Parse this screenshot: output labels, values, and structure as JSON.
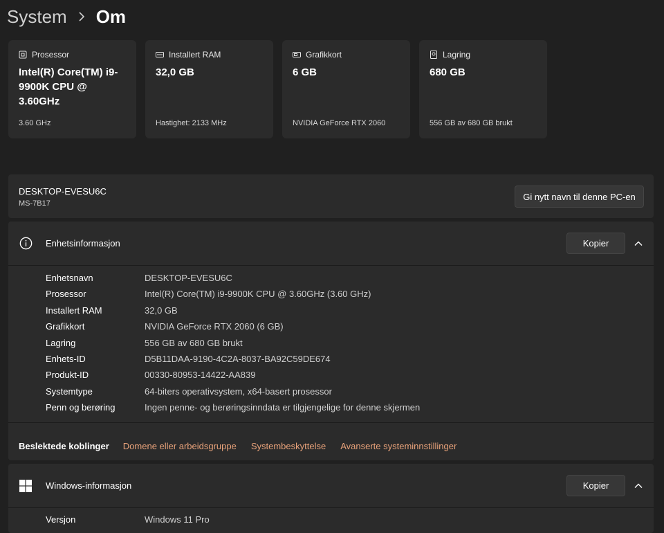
{
  "breadcrumb": {
    "parent": "System",
    "current": "Om"
  },
  "specs": [
    {
      "icon": "processor-icon",
      "label": "Prosessor",
      "value": "Intel(R) Core(TM) i9-9900K CPU @ 3.60GHz",
      "sub": "3.60 GHz"
    },
    {
      "icon": "ram-icon",
      "label": "Installert RAM",
      "value": "32,0 GB",
      "sub": "Hastighet: 2133 MHz"
    },
    {
      "icon": "gpu-icon",
      "label": "Grafikkort",
      "value": "6 GB",
      "sub": "NVIDIA GeForce RTX 2060"
    },
    {
      "icon": "storage-icon",
      "label": "Lagring",
      "value": "680 GB",
      "sub": "556 GB av 680 GB brukt"
    }
  ],
  "pc": {
    "name": "DESKTOP-EVESU6C",
    "model": "MS-7B17",
    "rename_label": "Gi nytt navn til denne PC-en"
  },
  "device_info": {
    "title": "Enhetsinformasjon",
    "copy_label": "Kopier",
    "rows": [
      {
        "key": "Enhetsnavn",
        "value": "DESKTOP-EVESU6C"
      },
      {
        "key": "Prosessor",
        "value": "Intel(R) Core(TM) i9-9900K CPU @ 3.60GHz (3.60 GHz)"
      },
      {
        "key": "Installert RAM",
        "value": "32,0 GB"
      },
      {
        "key": "Grafikkort",
        "value": "NVIDIA GeForce RTX 2060 (6 GB)"
      },
      {
        "key": "Lagring",
        "value": "556 GB av 680 GB brukt"
      },
      {
        "key": "Enhets-ID",
        "value": "D5B11DAA-9190-4C2A-8037-BA92C59DE674"
      },
      {
        "key": "Produkt-ID",
        "value": "00330-80953-14422-AA839"
      },
      {
        "key": "Systemtype",
        "value": "64-biters operativsystem, x64-basert prosessor"
      },
      {
        "key": "Penn og berøring",
        "value": "Ingen penne- og berøringsinndata er tilgjengelige for denne skjermen"
      }
    ],
    "related_label": "Beslektede koblinger",
    "related_links": [
      "Domene eller arbeidsgruppe",
      "Systembeskyttelse",
      "Avanserte systeminnstillinger"
    ]
  },
  "windows_info": {
    "title": "Windows-informasjon",
    "copy_label": "Kopier",
    "rows": [
      {
        "key": "Versjon",
        "value": "Windows 11 Pro"
      }
    ]
  },
  "colors": {
    "background": "#202020",
    "card": "#2b2b2b",
    "link": "#e8a27a",
    "button": "#373737"
  }
}
